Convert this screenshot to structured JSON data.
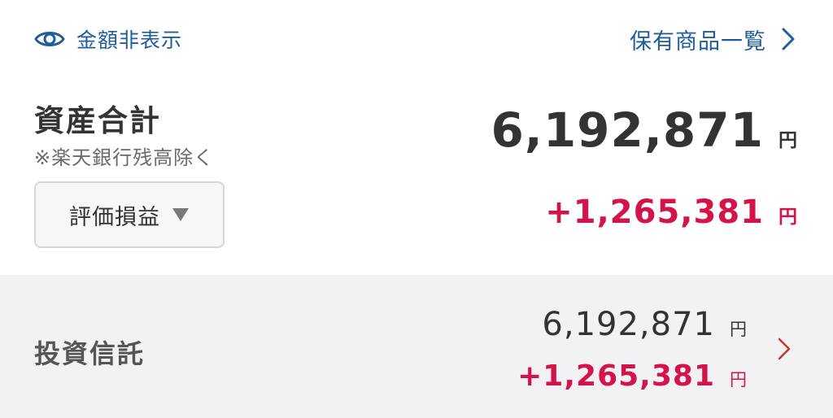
{
  "header": {
    "hide_amount_label": "金額非表示",
    "holdings_list_label": "保有商品一覧"
  },
  "total": {
    "title": "資産合計",
    "note": "※楽天銀行残高除く",
    "value": "6,192,871",
    "unit": "円",
    "selector_label": "評価損益",
    "gain": "+1,265,381",
    "gain_unit": "円"
  },
  "categories": [
    {
      "name": "投資信託",
      "value": "6,192,871",
      "unit": "円",
      "gain": "+1,265,381",
      "gain_unit": "円"
    }
  ],
  "icons": {
    "eye": "eye-icon",
    "chevron_right": "chevron-right-icon",
    "dropdown_caret": "caret-down-icon"
  },
  "colors": {
    "link": "#1f5d9a",
    "gain": "#d4134a",
    "text": "#333333",
    "row_bg": "#f2f2f4",
    "chevron_category": "#c0392b"
  }
}
